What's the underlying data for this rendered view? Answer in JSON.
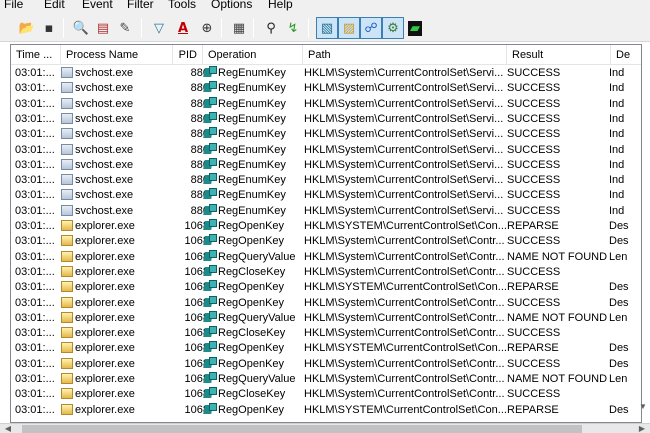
{
  "menu": [
    "File",
    "Edit",
    "Event",
    "Filter",
    "Tools",
    "Options",
    "Help"
  ],
  "toolbar": [
    {
      "icon": "open-folder-icon"
    },
    {
      "icon": "save-icon"
    },
    {
      "icon": "magnifier-icon"
    },
    {
      "icon": "autoscroll-icon"
    },
    {
      "icon": "clear-icon"
    },
    {
      "icon": "filter-icon"
    },
    {
      "icon": "highlight-icon"
    },
    {
      "icon": "target-icon"
    },
    {
      "icon": "process-tree-icon"
    },
    {
      "icon": "find-icon"
    },
    {
      "icon": "jump-icon"
    },
    {
      "icon": "registry-activity-icon",
      "pressed": true
    },
    {
      "icon": "file-activity-icon",
      "pressed": true
    },
    {
      "icon": "network-activity-icon",
      "pressed": true
    },
    {
      "icon": "process-activity-icon",
      "pressed": true
    },
    {
      "icon": "profiling-icon"
    }
  ],
  "columns": [
    "Time ...",
    "Process Name",
    "PID",
    "Operation",
    "Path",
    "Result",
    "De"
  ],
  "rows": [
    {
      "time": "03:01:...",
      "process": "svchost.exe",
      "pid": "880",
      "op": "RegEnumKey",
      "path": "HKLM\\System\\CurrentControlSet\\Servi...",
      "result": "SUCCESS",
      "detail": "Ind"
    },
    {
      "time": "03:01:...",
      "process": "svchost.exe",
      "pid": "880",
      "op": "RegEnumKey",
      "path": "HKLM\\System\\CurrentControlSet\\Servi...",
      "result": "SUCCESS",
      "detail": "Ind"
    },
    {
      "time": "03:01:...",
      "process": "svchost.exe",
      "pid": "880",
      "op": "RegEnumKey",
      "path": "HKLM\\System\\CurrentControlSet\\Servi...",
      "result": "SUCCESS",
      "detail": "Ind"
    },
    {
      "time": "03:01:...",
      "process": "svchost.exe",
      "pid": "880",
      "op": "RegEnumKey",
      "path": "HKLM\\System\\CurrentControlSet\\Servi...",
      "result": "SUCCESS",
      "detail": "Ind"
    },
    {
      "time": "03:01:...",
      "process": "svchost.exe",
      "pid": "880",
      "op": "RegEnumKey",
      "path": "HKLM\\System\\CurrentControlSet\\Servi...",
      "result": "SUCCESS",
      "detail": "Ind"
    },
    {
      "time": "03:01:...",
      "process": "svchost.exe",
      "pid": "880",
      "op": "RegEnumKey",
      "path": "HKLM\\System\\CurrentControlSet\\Servi...",
      "result": "SUCCESS",
      "detail": "Ind"
    },
    {
      "time": "03:01:...",
      "process": "svchost.exe",
      "pid": "880",
      "op": "RegEnumKey",
      "path": "HKLM\\System\\CurrentControlSet\\Servi...",
      "result": "SUCCESS",
      "detail": "Ind"
    },
    {
      "time": "03:01:...",
      "process": "svchost.exe",
      "pid": "880",
      "op": "RegEnumKey",
      "path": "HKLM\\System\\CurrentControlSet\\Servi...",
      "result": "SUCCESS",
      "detail": "Ind"
    },
    {
      "time": "03:01:...",
      "process": "svchost.exe",
      "pid": "880",
      "op": "RegEnumKey",
      "path": "HKLM\\System\\CurrentControlSet\\Servi...",
      "result": "SUCCESS",
      "detail": "Ind"
    },
    {
      "time": "03:01:...",
      "process": "svchost.exe",
      "pid": "880",
      "op": "RegEnumKey",
      "path": "HKLM\\System\\CurrentControlSet\\Servi...",
      "result": "SUCCESS",
      "detail": "Ind"
    },
    {
      "time": "03:01:...",
      "process": "explorer.exe",
      "pid": "1068",
      "op": "RegOpenKey",
      "path": "HKLM\\SYSTEM\\CurrentControlSet\\Con...",
      "result": "REPARSE",
      "detail": "Des"
    },
    {
      "time": "03:01:...",
      "process": "explorer.exe",
      "pid": "1068",
      "op": "RegOpenKey",
      "path": "HKLM\\System\\CurrentControlSet\\Contr...",
      "result": "SUCCESS",
      "detail": "Des"
    },
    {
      "time": "03:01:...",
      "process": "explorer.exe",
      "pid": "1068",
      "op": "RegQueryValue",
      "path": "HKLM\\System\\CurrentControlSet\\Contr...",
      "result": "NAME NOT FOUND",
      "detail": "Len"
    },
    {
      "time": "03:01:...",
      "process": "explorer.exe",
      "pid": "1068",
      "op": "RegCloseKey",
      "path": "HKLM\\System\\CurrentControlSet\\Contr...",
      "result": "SUCCESS",
      "detail": ""
    },
    {
      "time": "03:01:...",
      "process": "explorer.exe",
      "pid": "1068",
      "op": "RegOpenKey",
      "path": "HKLM\\SYSTEM\\CurrentControlSet\\Con...",
      "result": "REPARSE",
      "detail": "Des"
    },
    {
      "time": "03:01:...",
      "process": "explorer.exe",
      "pid": "1068",
      "op": "RegOpenKey",
      "path": "HKLM\\System\\CurrentControlSet\\Contr...",
      "result": "SUCCESS",
      "detail": "Des"
    },
    {
      "time": "03:01:...",
      "process": "explorer.exe",
      "pid": "1068",
      "op": "RegQueryValue",
      "path": "HKLM\\System\\CurrentControlSet\\Contr...",
      "result": "NAME NOT FOUND",
      "detail": "Len"
    },
    {
      "time": "03:01:...",
      "process": "explorer.exe",
      "pid": "1068",
      "op": "RegCloseKey",
      "path": "HKLM\\System\\CurrentControlSet\\Contr...",
      "result": "SUCCESS",
      "detail": ""
    },
    {
      "time": "03:01:...",
      "process": "explorer.exe",
      "pid": "1068",
      "op": "RegOpenKey",
      "path": "HKLM\\SYSTEM\\CurrentControlSet\\Con...",
      "result": "REPARSE",
      "detail": "Des"
    },
    {
      "time": "03:01:...",
      "process": "explorer.exe",
      "pid": "1068",
      "op": "RegOpenKey",
      "path": "HKLM\\System\\CurrentControlSet\\Contr...",
      "result": "SUCCESS",
      "detail": "Des"
    },
    {
      "time": "03:01:...",
      "process": "explorer.exe",
      "pid": "1068",
      "op": "RegQueryValue",
      "path": "HKLM\\System\\CurrentControlSet\\Contr...",
      "result": "NAME NOT FOUND",
      "detail": "Len"
    },
    {
      "time": "03:01:...",
      "process": "explorer.exe",
      "pid": "1068",
      "op": "RegCloseKey",
      "path": "HKLM\\System\\CurrentControlSet\\Contr...",
      "result": "SUCCESS",
      "detail": ""
    },
    {
      "time": "03:01:...",
      "process": "explorer.exe",
      "pid": "1068",
      "op": "RegOpenKey",
      "path": "HKLM\\SYSTEM\\CurrentControlSet\\Con...",
      "result": "REPARSE",
      "detail": "Des"
    }
  ],
  "icons": {
    "process_svchost": "service-process-icon",
    "process_explorer": "explorer-process-icon",
    "operation": "registry-operation-icon"
  }
}
